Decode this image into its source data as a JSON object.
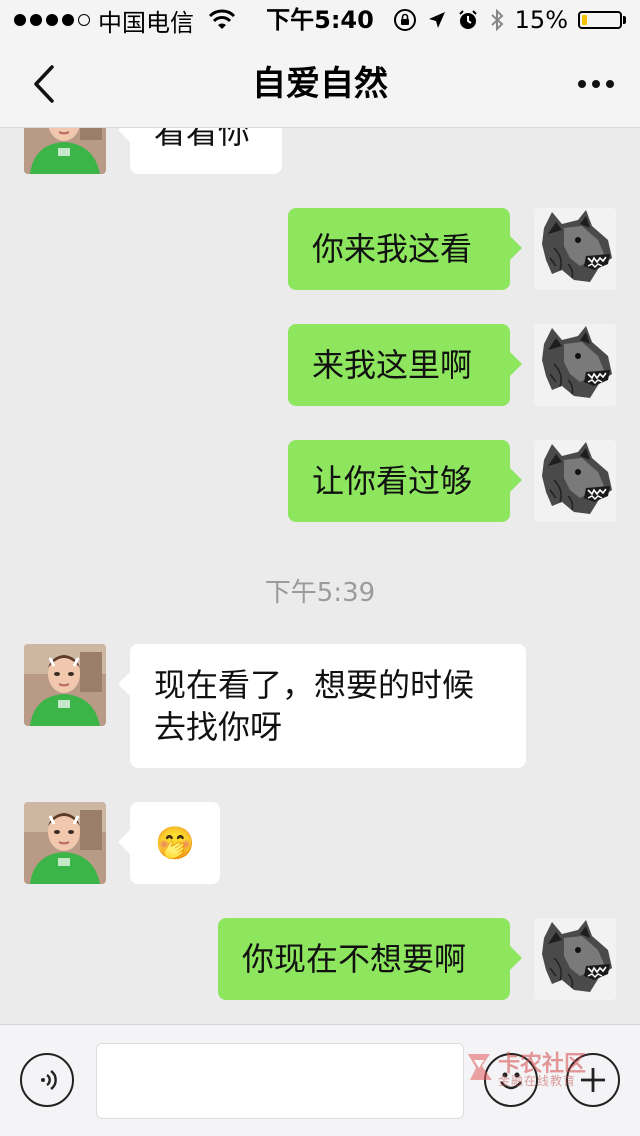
{
  "status_bar": {
    "carrier": "中国电信",
    "time": "下午5:40",
    "battery_text": "15%",
    "battery_level": 0.15,
    "battery_color": "#f5c400",
    "signal_bars_filled": 4,
    "signal_bars_total": 5,
    "icons": [
      "wifi-icon",
      "orientation-lock-icon",
      "location-icon",
      "alarm-icon",
      "bluetooth-icon",
      "battery-icon"
    ]
  },
  "nav": {
    "back_icon": "chevron-left-icon",
    "title": "自爱自然",
    "more_icon": "more-dots-icon"
  },
  "messages": [
    {
      "side": "left",
      "text": "看看你",
      "avatar": "contact-avatar"
    },
    {
      "side": "right",
      "text": "你来我这看",
      "avatar": "wolf-avatar"
    },
    {
      "side": "right",
      "text": "来我这里啊",
      "avatar": "wolf-avatar"
    },
    {
      "side": "right",
      "text": "让你看过够",
      "avatar": "wolf-avatar"
    },
    {
      "side": "left",
      "text_line1": "现在看了，想要的时候",
      "text_line2": "去找你呀",
      "avatar": "contact-avatar"
    },
    {
      "side": "left",
      "emoji": "🤭",
      "avatar": "contact-avatar"
    },
    {
      "side": "right",
      "text": "你现在不想要啊",
      "avatar": "wolf-avatar"
    }
  ],
  "timestamp": "下午5:39",
  "input_bar": {
    "voice_icon": "voice-icon",
    "input_value": "",
    "emoji_icon": "emoji-icon",
    "plus_icon": "plus-icon"
  },
  "watermark": {
    "title": "卡农社区",
    "subtitle": "金融在线教育"
  },
  "colors": {
    "chat_bg": "#ebebeb",
    "bubble_sent": "#8ee65f",
    "bubble_received": "#ffffff",
    "timestamp": "#9b9b9b"
  }
}
